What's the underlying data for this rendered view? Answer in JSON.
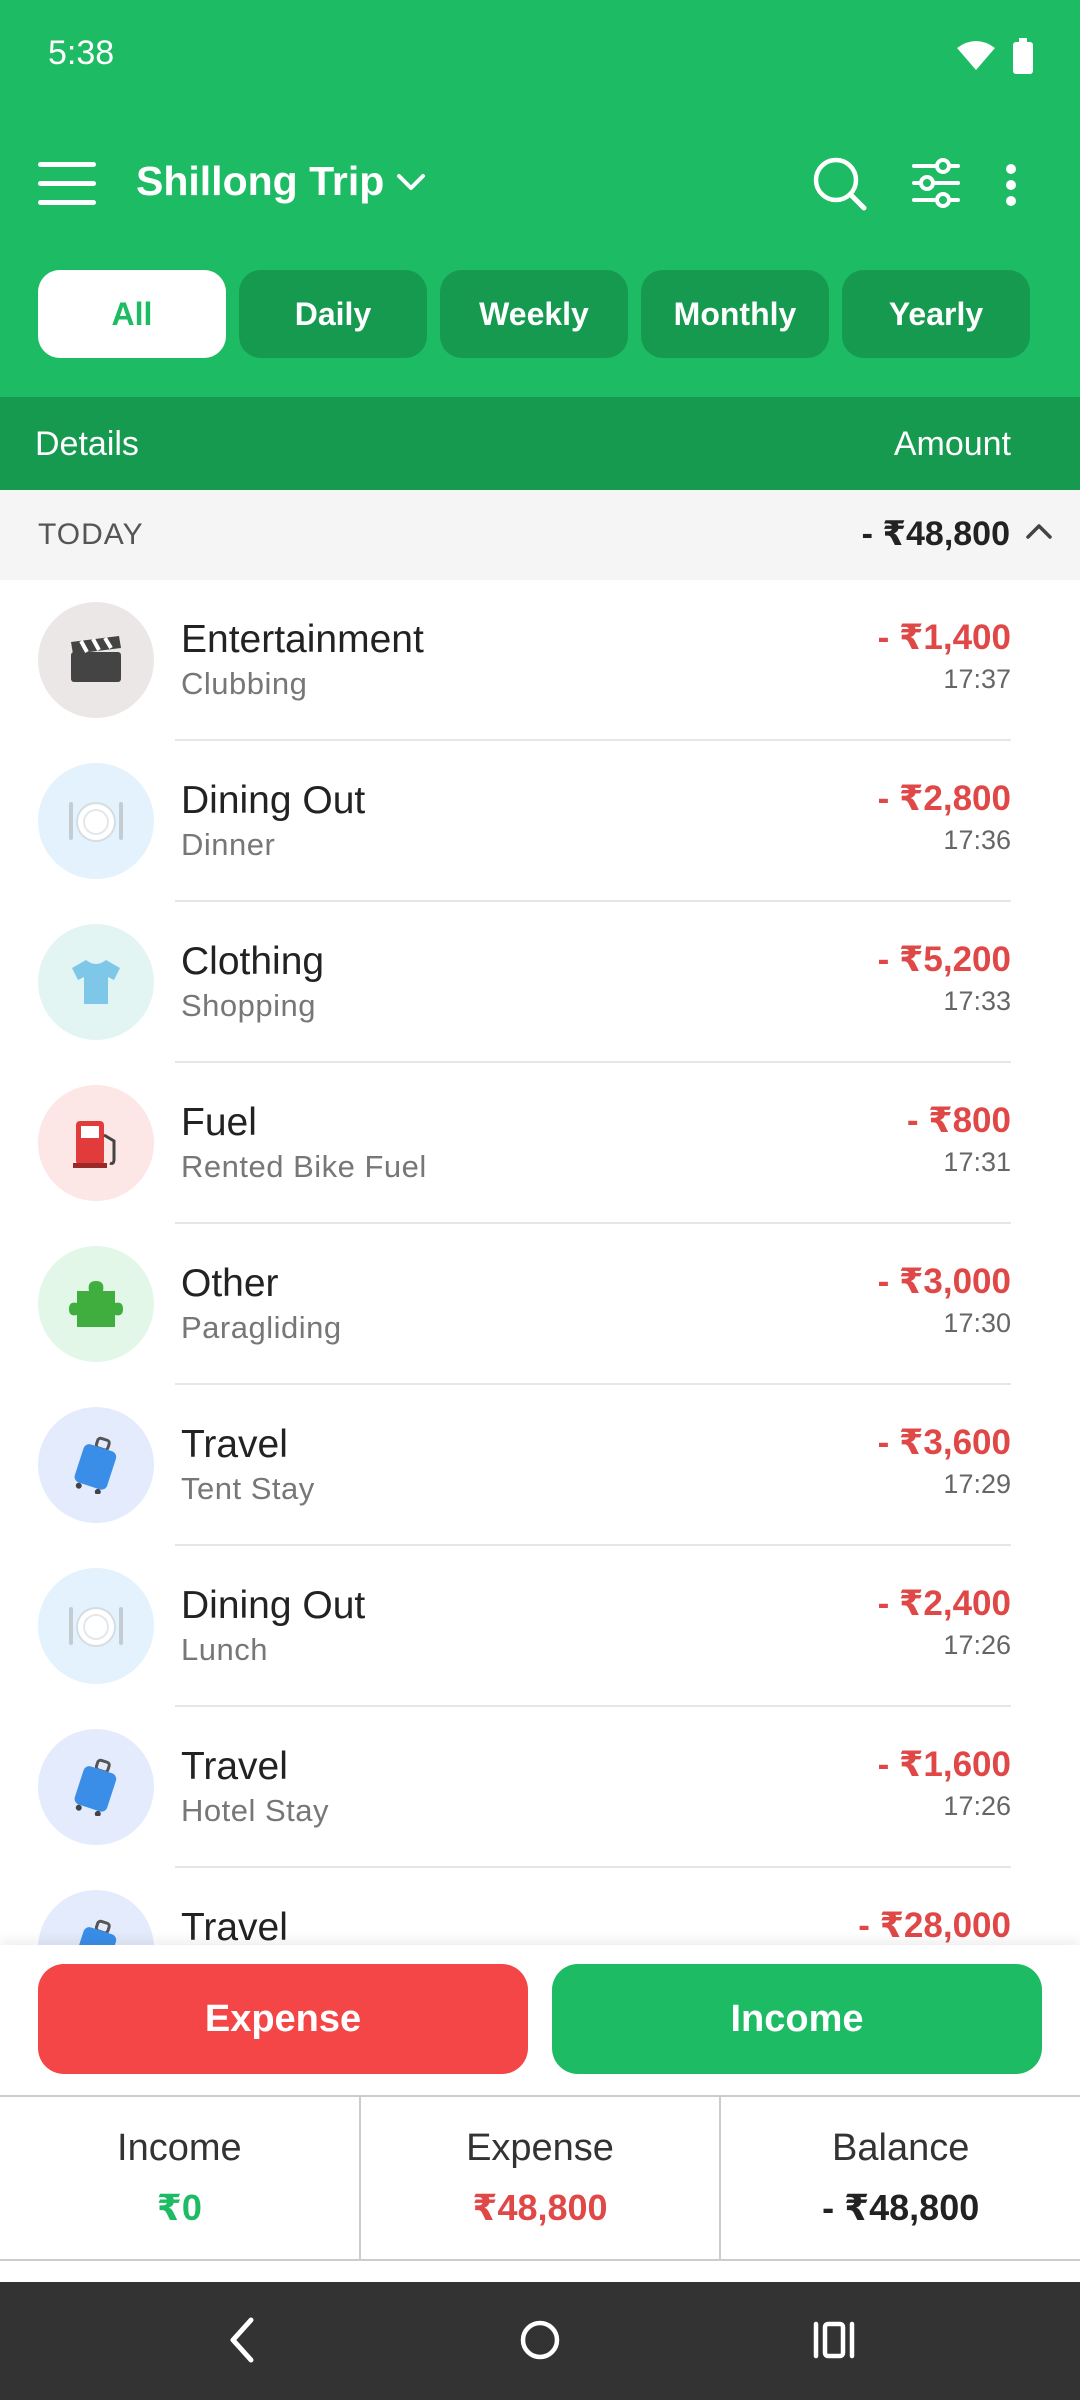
{
  "status_bar": {
    "time": "5:38"
  },
  "toolbar": {
    "title": "Shillong Trip"
  },
  "tabs": [
    "All",
    "Daily",
    "Weekly",
    "Monthly",
    "Yearly"
  ],
  "columns": {
    "details": "Details",
    "amount": "Amount"
  },
  "group": {
    "label": "TODAY",
    "total": "- ₹48,800"
  },
  "transactions": [
    {
      "category": "Entertainment",
      "note": "Clubbing",
      "amount": "- ₹1,400",
      "time": "17:37",
      "icon": "clapperboard-icon",
      "icon_bg": "#ebe7e6"
    },
    {
      "category": "Dining Out",
      "note": "Dinner",
      "amount": "- ₹2,800",
      "time": "17:36",
      "icon": "plate-cutlery-icon",
      "icon_bg": "#e3f2fc"
    },
    {
      "category": "Clothing",
      "note": "Shopping",
      "amount": "- ₹5,200",
      "time": "17:33",
      "icon": "tshirt-icon",
      "icon_bg": "#e2f5f3"
    },
    {
      "category": "Fuel",
      "note": "Rented Bike Fuel",
      "amount": "- ₹800",
      "time": "17:31",
      "icon": "fuel-pump-icon",
      "icon_bg": "#fde6e6"
    },
    {
      "category": "Other",
      "note": "Paragliding",
      "amount": "- ₹3,000",
      "time": "17:30",
      "icon": "puzzle-icon",
      "icon_bg": "#e3f7e8"
    },
    {
      "category": "Travel",
      "note": "Tent Stay",
      "amount": "- ₹3,600",
      "time": "17:29",
      "icon": "suitcase-icon",
      "icon_bg": "#e3ebfc"
    },
    {
      "category": "Dining Out",
      "note": "Lunch",
      "amount": "- ₹2,400",
      "time": "17:26",
      "icon": "plate-cutlery-icon",
      "icon_bg": "#e3f2fc"
    },
    {
      "category": "Travel",
      "note": "Hotel Stay",
      "amount": "- ₹1,600",
      "time": "17:26",
      "icon": "suitcase-icon",
      "icon_bg": "#e3ebfc"
    },
    {
      "category": "Travel",
      "note": "",
      "amount": "- ₹28,000",
      "time": "",
      "icon": "suitcase-icon",
      "icon_bg": "#e3ebfc"
    }
  ],
  "actions": {
    "expense_label": "Expense",
    "income_label": "Income"
  },
  "summary": {
    "income_label": "Income",
    "income_value": "₹0",
    "expense_label": "Expense",
    "expense_value": "₹48,800",
    "balance_label": "Balance",
    "balance_value": "- ₹48,800"
  },
  "colors": {
    "brand_green": "#1dbb63",
    "dark_green": "#169a50",
    "expense_red": "#e04848",
    "expense_button": "#f44547"
  }
}
